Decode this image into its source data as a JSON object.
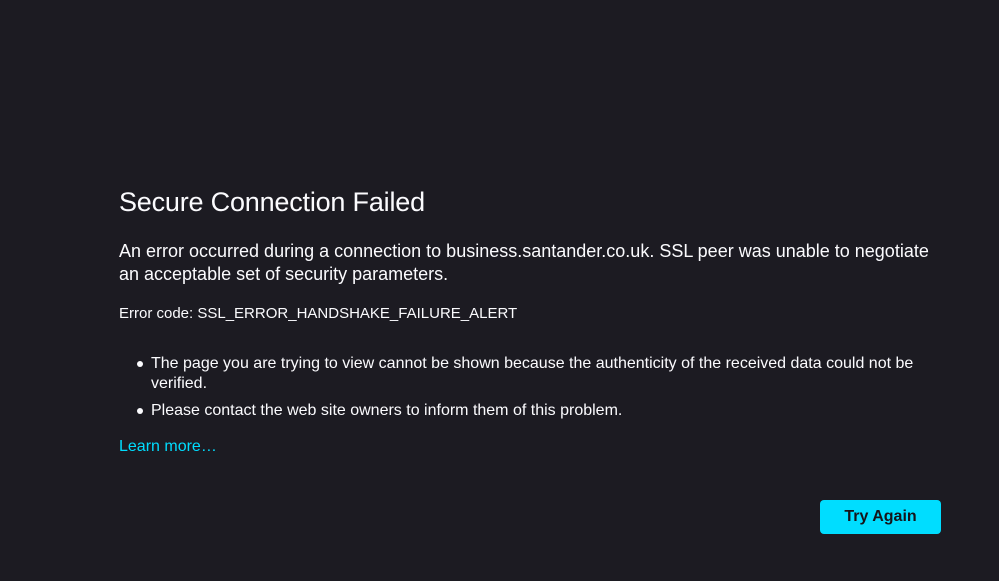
{
  "error_page": {
    "title": "Secure Connection Failed",
    "description": "An error occurred during a connection to business.santander.co.uk. SSL peer was unable to negotiate an acceptable set of security parameters.",
    "error_code_line": "Error code: SSL_ERROR_HANDSHAKE_FAILURE_ALERT",
    "bullets": [
      "The page you are trying to view cannot be shown because the authenticity of the received data could not be verified.",
      "Please contact the web site owners to inform them of this problem."
    ],
    "learn_more_label": "Learn more…",
    "try_again_label": "Try Again"
  },
  "colors": {
    "background": "#1c1b22",
    "text": "#fbfbfe",
    "accent": "#00ddff",
    "button_text": "#15141a"
  }
}
